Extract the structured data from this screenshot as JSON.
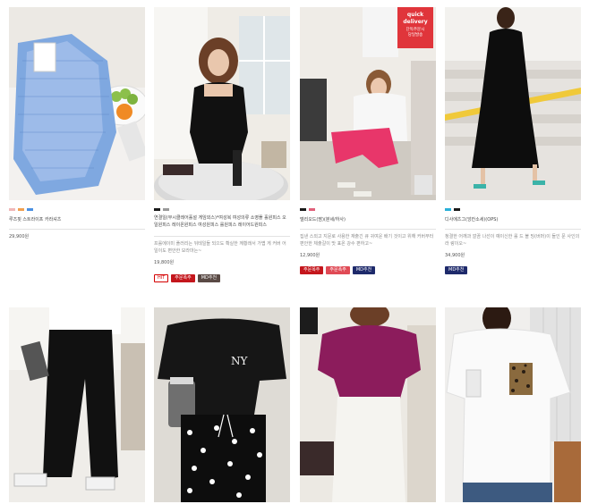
{
  "products_row1": [
    {
      "swatch_colors": [
        "#f0b7b7",
        "#f0a050",
        "#4a90e2"
      ],
      "name": "루즈핏 스트라이프 카라셔츠",
      "description": "",
      "price": "29,900원",
      "badges": []
    },
    {
      "swatch_colors": [
        "#1a1a1a",
        "#999999"
      ],
      "name": "연결일(무시클레어홀설 게임외스)*여성복 여성의류 소영플 홀원피스 오일원피스 레이온원피스 여성원피스 롤원피스 레이어드원피스",
      "description": "프롤에이미 플러리는 뒤테일들 되으도 확실한 께황래서 가볍 게 커버 어일이도 편안한 모라마는~",
      "price": "19,800원",
      "badges": [
        {
          "label": "HIT",
          "style": "hit"
        },
        {
          "label": "주문폭주",
          "style": "red"
        },
        {
          "label": "MD추천",
          "style": "md"
        }
      ]
    },
    {
      "swatch_colors": [
        "#1a1a1a",
        "#e0607a"
      ],
      "name": "델리오드(땀)(분세/하사)",
      "description": "집낸 스외고 지문로 사용한 재출긴 큐 귀여운 배기 것이고 위해 커버부터 편안한 체출갈이 맛 표온 강수 편하고~",
      "price": "12,900원",
      "badges": [
        {
          "label": "주문폭주",
          "style": "red"
        },
        {
          "label": "주문폭주",
          "style": "rose"
        },
        {
          "label": "MD추천",
          "style": "navy"
        }
      ]
    },
    {
      "swatch_colors": [
        "#2ab0d8",
        "#1a1a1a"
      ],
      "name": "디사에츠그(앙칸소세)(OPS)",
      "description": "청결한 어깨과 깔끔 나선이 예이신한 롤 드 볼 밍(버머)이 들인 문 사인의 라 랑이오~",
      "price": "34,900원",
      "badges": [
        {
          "label": "MD추천",
          "style": "navy"
        }
      ]
    }
  ],
  "quick_delivery": {
    "line1": "quick",
    "line2": "delivery",
    "line3": "단독주문시",
    "line4": "당일발송"
  }
}
